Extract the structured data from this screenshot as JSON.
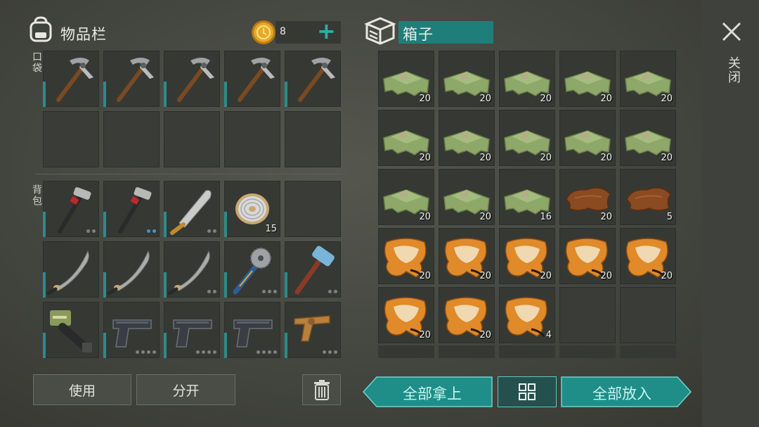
{
  "inventory": {
    "title": "物品栏",
    "coins": "8",
    "add_symbol": "+",
    "pocket_label": "口袋",
    "backpack_label": "背包",
    "pocket_slots": [
      {
        "item": "pickaxe"
      },
      {
        "item": "pickaxe"
      },
      {
        "item": "pickaxe"
      },
      {
        "item": "pickaxe"
      },
      {
        "item": "pickaxe"
      },
      {
        "item": "empty"
      },
      {
        "item": "empty"
      },
      {
        "item": "empty"
      },
      {
        "item": "empty"
      },
      {
        "item": "empty"
      }
    ],
    "backpack_slots": [
      {
        "item": "crowbar-hammer",
        "dots": 2
      },
      {
        "item": "crowbar-hammer",
        "dots": 2,
        "blue_dots": 2
      },
      {
        "item": "machete",
        "dots": 2
      },
      {
        "item": "wire-spool",
        "count": "15"
      },
      {
        "item": "empty"
      },
      {
        "item": "katana"
      },
      {
        "item": "katana"
      },
      {
        "item": "katana",
        "dots": 2
      },
      {
        "item": "sawblade-mace",
        "dots": 3
      },
      {
        "item": "sledgehammer",
        "dots": 2
      },
      {
        "item": "chainsaw-launcher"
      },
      {
        "item": "pistol",
        "dots": 4
      },
      {
        "item": "pistol",
        "dots": 4
      },
      {
        "item": "pistol",
        "dots": 4
      },
      {
        "item": "revolver",
        "dots": 3
      }
    ],
    "use_button": "使用",
    "split_button": "分开"
  },
  "box": {
    "title": "箱子",
    "slots": [
      {
        "item": "cloth",
        "count": "20"
      },
      {
        "item": "cloth",
        "count": "20"
      },
      {
        "item": "cloth",
        "count": "20"
      },
      {
        "item": "cloth",
        "count": "20"
      },
      {
        "item": "cloth",
        "count": "20"
      },
      {
        "item": "cloth",
        "count": "20"
      },
      {
        "item": "cloth",
        "count": "20"
      },
      {
        "item": "cloth",
        "count": "20"
      },
      {
        "item": "cloth",
        "count": "20"
      },
      {
        "item": "cloth",
        "count": "20"
      },
      {
        "item": "cloth",
        "count": "20"
      },
      {
        "item": "cloth",
        "count": "20"
      },
      {
        "item": "cloth",
        "count": "16"
      },
      {
        "item": "leather",
        "count": "20"
      },
      {
        "item": "leather",
        "count": "5"
      },
      {
        "item": "fox-pelt",
        "count": "20"
      },
      {
        "item": "fox-pelt",
        "count": "20"
      },
      {
        "item": "fox-pelt",
        "count": "20"
      },
      {
        "item": "fox-pelt",
        "count": "20"
      },
      {
        "item": "fox-pelt",
        "count": "20"
      },
      {
        "item": "fox-pelt",
        "count": "20"
      },
      {
        "item": "fox-pelt",
        "count": "20"
      },
      {
        "item": "fox-pelt",
        "count": "4"
      },
      {
        "item": "empty"
      },
      {
        "item": "empty"
      }
    ],
    "take_all_button": "全部拿上",
    "put_all_button": "全部放入"
  },
  "close_label": "关闭",
  "colors": {
    "accent": "#1f8e88",
    "durability": "#2b8c8a",
    "coin": "#e0a21e"
  }
}
